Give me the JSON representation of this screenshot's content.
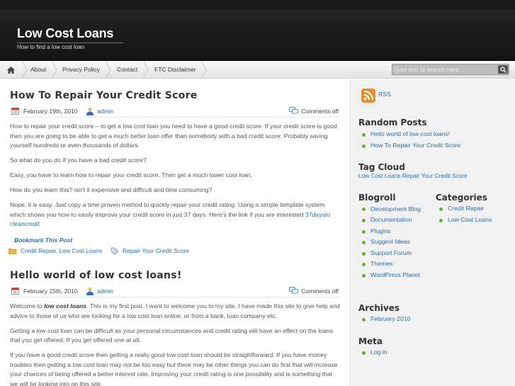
{
  "site": {
    "title": "Low Cost Loans",
    "description": "How to find a low cost loan"
  },
  "nav": {
    "items": [
      "About",
      "Privacy Policy",
      "Contact",
      "FTC Disclaimer"
    ]
  },
  "search": {
    "placeholder": "Type text to search here..."
  },
  "posts": [
    {
      "title": "How To Repair Your Credit Score",
      "date": "February 19th, 2010",
      "author": "admin",
      "comments": "Comments off",
      "paragraphs": [
        "How to repair your credit score – to get a low cost loan you need to have a good credit score. If your credit score is good then you are going to be able to get a much better loan offer than somebody with a bad credit score. Probably saving yourself hundreds or even thousands of dollars.",
        "So what do you do if you have a bad credit score?",
        "Easy, you have to learn how to repair your credit score. Then get a much lower cost loan.",
        "How do you learn this? isn't it expensive and difficult and time consuming?"
      ],
      "last_paragraph": "Nope, it is easy. Just copy a time proven method to quickly repair your credit rating. Using a simple template system which shows you how to easily improve your credit score in just 37 days. Here's the link if you are interested ",
      "link_text": "37daysto cleancredit",
      "bookmark": "Bookmark This Post",
      "categories": "Credit Repair, Low Cost Loans",
      "tags": "Repair Your Credit Score"
    },
    {
      "title": "Hello world of low cost loans!",
      "date": "February 15th, 2010",
      "author": "admin",
      "comments": "Comments off",
      "intro_before": "Welcome to ",
      "intro_em": "low cost loans",
      "intro_after": ". This is my first post. I want to welcome you to my site. I have made this site to give help and advice to those of us who are looking for a low cost loan online, or from a bank, loan company etc.",
      "paragraphs": [
        "Getting a low cost loan can be difficult as your personal circumstances and credit rating will have an effect on the loans that you get offered. If you get offered one at all.",
        "If you have a good credit score then getting a really good low cost loan should be straightforward. If you have money troubles then getting a low cost loan may not be too easy but there may be other things you can do first that will increase your chances of being offered a better interest rate. Improving your credit rating is one possibility and is something that we will be looking into on this site."
      ]
    }
  ],
  "sidebar": {
    "rss": "RSS",
    "random_posts": {
      "title": "Random Posts",
      "items": [
        "Hello world of low cost loans!",
        "How To Repair Your Credit Score"
      ]
    },
    "tag_cloud": {
      "title": "Tag Cloud",
      "tags": [
        "Low Cost Loans",
        "Repair Your Credit Score"
      ]
    },
    "blogroll": {
      "title": "Blogroll",
      "items": [
        "Development Blog",
        "Documentation",
        "Plugins",
        "Suggest Ideas",
        "Support Forum",
        "Themes",
        "WordPress Planet"
      ]
    },
    "categories": {
      "title": "Categories",
      "items": [
        "Credit Repair",
        "Low Cost Loans"
      ]
    },
    "archives": {
      "title": "Archives",
      "items": [
        "February 2010"
      ]
    },
    "meta": {
      "title": "Meta",
      "items": [
        "Log in"
      ]
    }
  },
  "colors": {
    "link": "#2b6ea8",
    "bullet": "#6cad2c",
    "header": "#1c1c1c",
    "rss": "#f08a24"
  }
}
